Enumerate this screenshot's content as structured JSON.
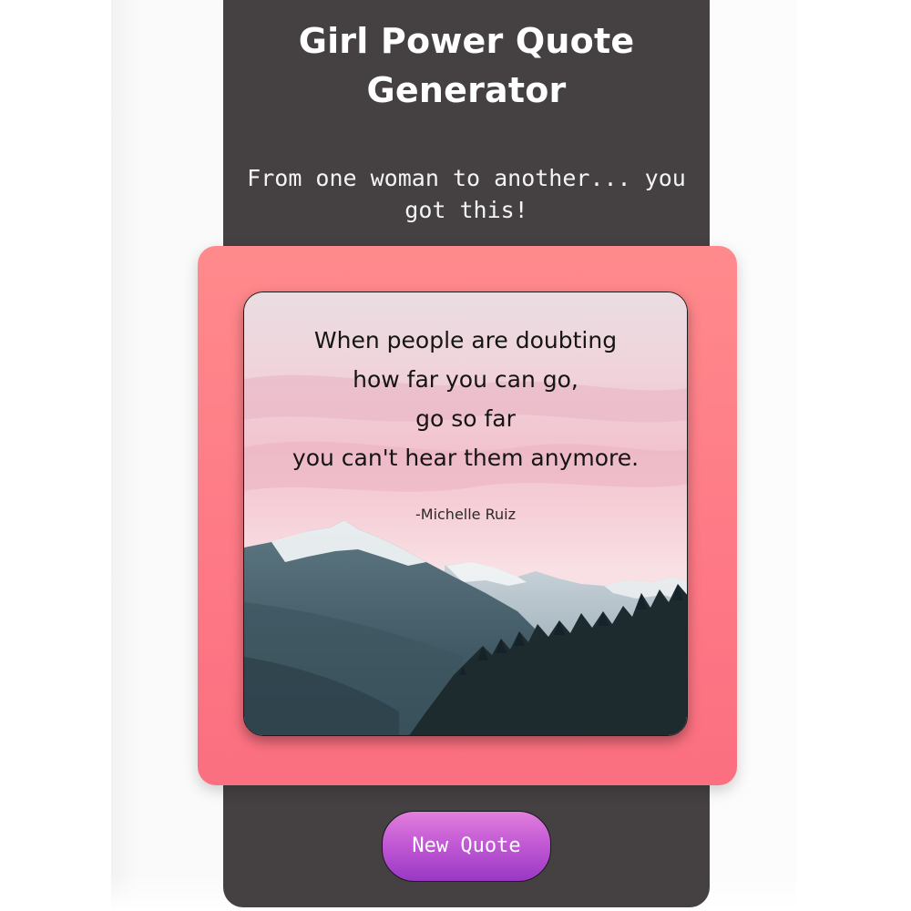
{
  "header": {
    "title_line1": "Girl Power Quote",
    "title_line2": "Generator",
    "subtitle_line1": "From one woman to another... you",
    "subtitle_line2": "got this!"
  },
  "quote": {
    "lines": [
      "When people are doubting",
      "how far you can go,",
      "go so far",
      "you can't hear them anymore."
    ],
    "author": "-Michelle Ruiz",
    "image_icon": "mountain-landscape"
  },
  "controls": {
    "new_quote_label": "New Quote"
  },
  "colors": {
    "card_background": "#454142",
    "frame_pink": "#fe7a86",
    "button_gradient_top": "#e27fdb",
    "button_gradient_bottom": "#9a38c4",
    "text_white": "#ffffff"
  }
}
